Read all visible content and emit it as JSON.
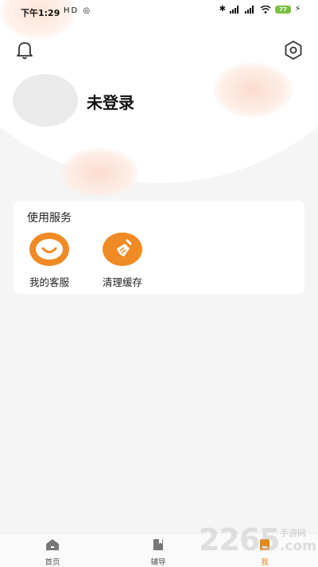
{
  "status_bar": {
    "time": "下午1:29",
    "left_icons": "HD ◎",
    "battery": "77"
  },
  "profile": {
    "username": "未登录"
  },
  "services": {
    "title": "使用服务",
    "items": [
      {
        "label": "我的客服",
        "icon": "smile-icon"
      },
      {
        "label": "清理缓存",
        "icon": "broom-icon"
      }
    ]
  },
  "tabs": [
    {
      "label": "首页",
      "icon": "home-icon"
    },
    {
      "label": "辅导",
      "icon": "book-icon"
    },
    {
      "label": "我",
      "icon": "user-icon",
      "active": true
    }
  ],
  "colors": {
    "accent": "#f08a24",
    "active_tab": "#e08a1c"
  },
  "watermark": {
    "number": "2265",
    "text": "手游网",
    "domain": ".com"
  }
}
